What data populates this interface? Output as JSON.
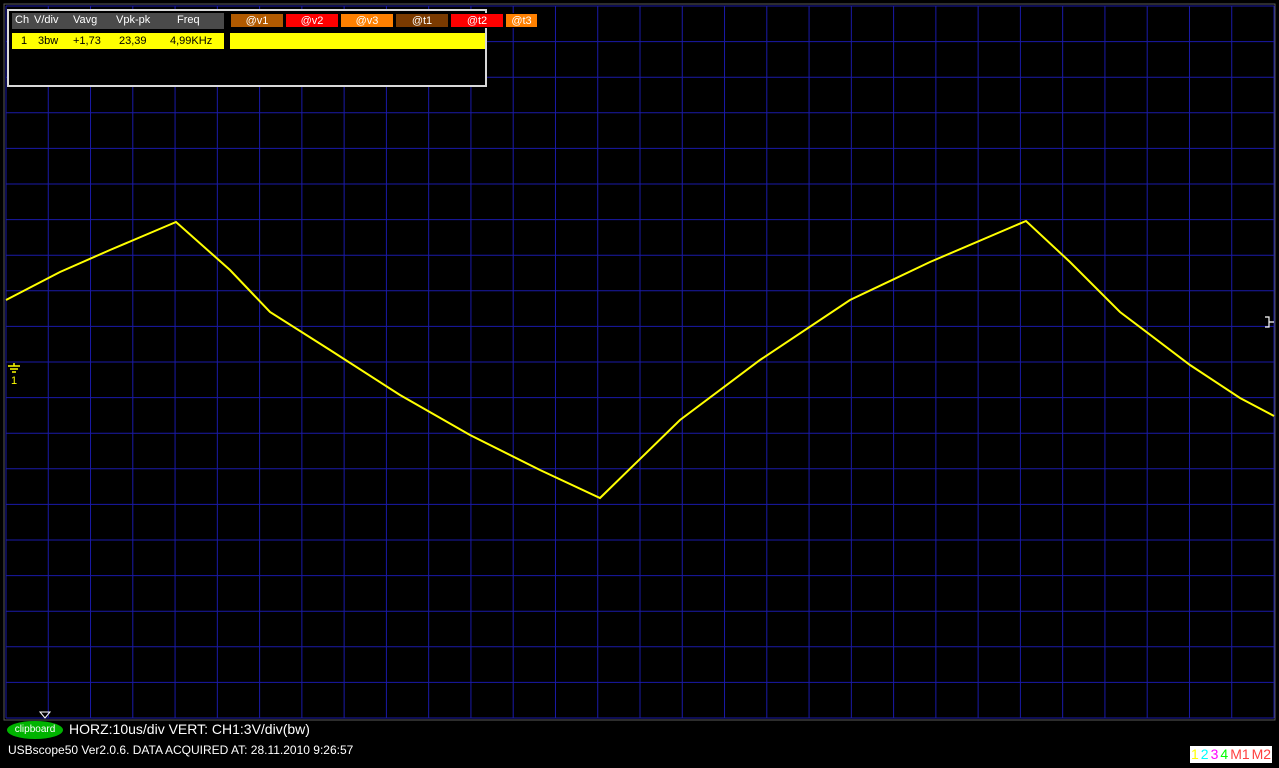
{
  "measurement_panel": {
    "headers": [
      "Ch",
      "V/div",
      "Vavg",
      "Vpk-pk",
      "Freq"
    ],
    "marker_buttons": [
      {
        "label": "@v1",
        "color": "#b15a00"
      },
      {
        "label": "@v2",
        "color": "#ff0000"
      },
      {
        "label": "@v3",
        "color": "#ff8000"
      },
      {
        "label": "@t1",
        "color": "#7a3a00"
      },
      {
        "label": "@t2",
        "color": "#ff0000"
      },
      {
        "label": "@t3",
        "color": "#ff8000"
      }
    ],
    "row": {
      "ch": "1",
      "vdiv": "3bw",
      "vavg": "+1,73",
      "vpkpk": "23,39",
      "freq": "4,99KHz"
    }
  },
  "status": {
    "horz_vert": "HORZ:10us/div VERT: CH1:3V/div(bw)",
    "version": "USBscope50 Ver2.0.6.  DATA ACQUIRED AT: 28.11.2010 9:26:57",
    "clipboard": "clipboard"
  },
  "channel_buttons": [
    {
      "label": "1",
      "color": "#ffff00"
    },
    {
      "label": "2",
      "color": "#00ffff"
    },
    {
      "label": "3",
      "color": "#ff00ff"
    },
    {
      "label": "4",
      "color": "#00ff00"
    },
    {
      "label": "M1",
      "color": "#ff4040"
    },
    {
      "label": "M2",
      "color": "#ff4040"
    }
  ],
  "colors": {
    "grid": "#1a1aa8",
    "trace": "#ffff00",
    "background": "#000000"
  },
  "waveform": {
    "type": "triangle",
    "channel": "CH1"
  }
}
